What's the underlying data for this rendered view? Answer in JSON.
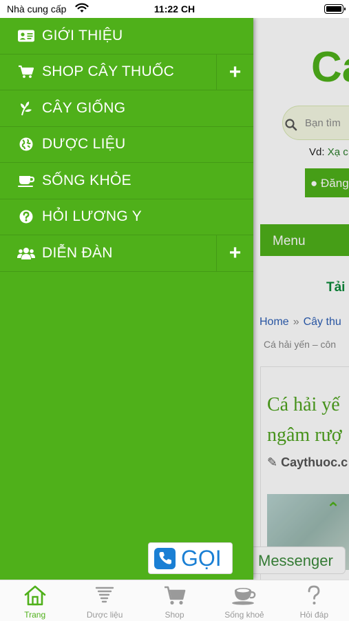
{
  "status_bar": {
    "carrier": "Nhà cung cấp",
    "time": "11:22 CH"
  },
  "drawer": {
    "items": [
      {
        "label": "GIỚI THIỆU",
        "icon": "id-card-icon",
        "expandable": false
      },
      {
        "label": "SHOP CÂY THUỐC",
        "icon": "shopping-cart-icon",
        "expandable": true
      },
      {
        "label": "CÂY GIỐNG",
        "icon": "leaf-icon",
        "expandable": false
      },
      {
        "label": "DƯỢC LIỆU",
        "icon": "globe-icon",
        "expandable": false
      },
      {
        "label": "SỐNG KHỎE",
        "icon": "coffee-cup-icon",
        "expandable": false
      },
      {
        "label": "HỎI LƯƠNG Y",
        "icon": "question-circle-icon",
        "expandable": false
      },
      {
        "label": "DIỄN ĐÀN",
        "icon": "users-icon",
        "expandable": true
      }
    ],
    "expand_symbol": "+",
    "background_color": "#4fb01a"
  },
  "call_button": {
    "label": "GỌI",
    "icon": "phone-icon",
    "color": "#1a7fd4"
  },
  "background_page": {
    "logo": "Ca",
    "search_placeholder": "Bạn tìm",
    "example_prefix": "Vd:",
    "example_link": "Xạ c",
    "login_label": "Đăng",
    "menu_label": "Menu",
    "download_label": "Tải",
    "breadcrumb_home": "Home",
    "breadcrumb_separator": "»",
    "breadcrumb_category": "Cây thu",
    "breadcrumb_current": "Cá hải yến – côn",
    "article_title": "Cá hải yế ngâm rượ",
    "article_source": "Caythuoc.c",
    "messenger_label": "Messenger"
  },
  "tab_bar": {
    "tabs": [
      {
        "label": "Trang",
        "icon": "home-icon",
        "active": true
      },
      {
        "label": "Dược liệu",
        "icon": "tornado-icon",
        "active": false
      },
      {
        "label": "Shop",
        "icon": "cart-icon",
        "active": false
      },
      {
        "label": "Sống khoẻ",
        "icon": "cup-icon",
        "active": false
      },
      {
        "label": "Hỏi đáp",
        "icon": "question-mark-icon",
        "active": false
      }
    ],
    "active_color": "#4fb01a",
    "inactive_color": "#999999"
  }
}
